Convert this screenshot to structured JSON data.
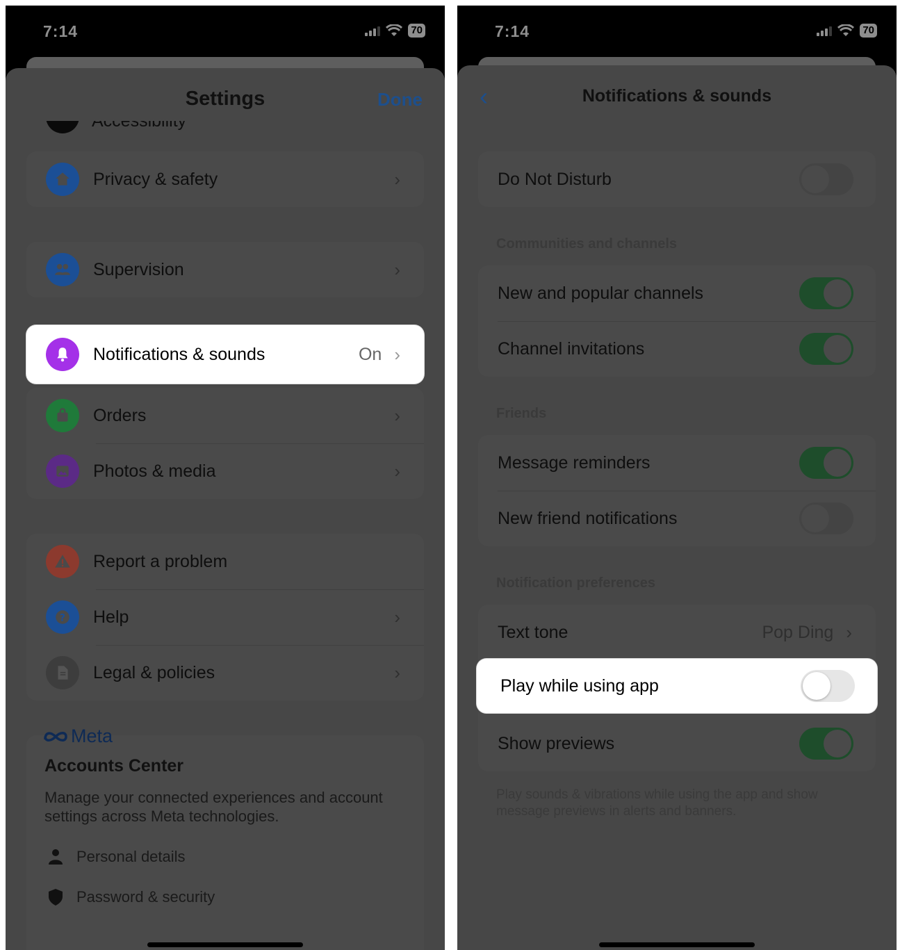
{
  "left": {
    "status": {
      "time": "7:14",
      "battery": "70"
    },
    "title": "Settings",
    "done_label": "Done",
    "partial_item": "Accessibility",
    "items": {
      "privacy": "Privacy & safety",
      "supervision": "Supervision",
      "notifications": "Notifications & sounds",
      "notifications_value": "On",
      "orders": "Orders",
      "photos": "Photos & media",
      "report": "Report a problem",
      "help": "Help",
      "legal": "Legal & policies"
    },
    "accounts": {
      "brand": "Meta",
      "title": "Accounts Center",
      "description": "Manage your connected experiences and account settings across Meta technologies.",
      "personal": "Personal details",
      "password": "Password & security"
    },
    "colors": {
      "privacy": "#1b4f96",
      "supervision": "#1b4f96",
      "notifications": "#a431e8",
      "orders": "#1f7a3a",
      "photos": "#5b2a86",
      "report": "#8c3a2e",
      "help": "#1b4f96",
      "legal": "#4a4a4a"
    }
  },
  "right": {
    "status": {
      "time": "7:14",
      "battery": "70"
    },
    "title": "Notifications & sounds",
    "do_not_disturb": {
      "label": "Do Not Disturb",
      "on": false
    },
    "sections": {
      "communities": "Communities and channels",
      "friends": "Friends",
      "preferences": "Notification preferences"
    },
    "new_popular": {
      "label": "New and popular channels",
      "on": true
    },
    "channel_invites": {
      "label": "Channel invitations",
      "on": true
    },
    "message_reminders": {
      "label": "Message reminders",
      "on": true
    },
    "new_friend": {
      "label": "New friend notifications",
      "on": false
    },
    "text_tone": {
      "label": "Text tone",
      "value": "Pop Ding"
    },
    "play_while": {
      "label": "Play while using app",
      "on": false
    },
    "show_previews": {
      "label": "Show previews",
      "on": true
    },
    "footer": "Play sounds & vibrations while using the app and show message previews in alerts and banners."
  }
}
